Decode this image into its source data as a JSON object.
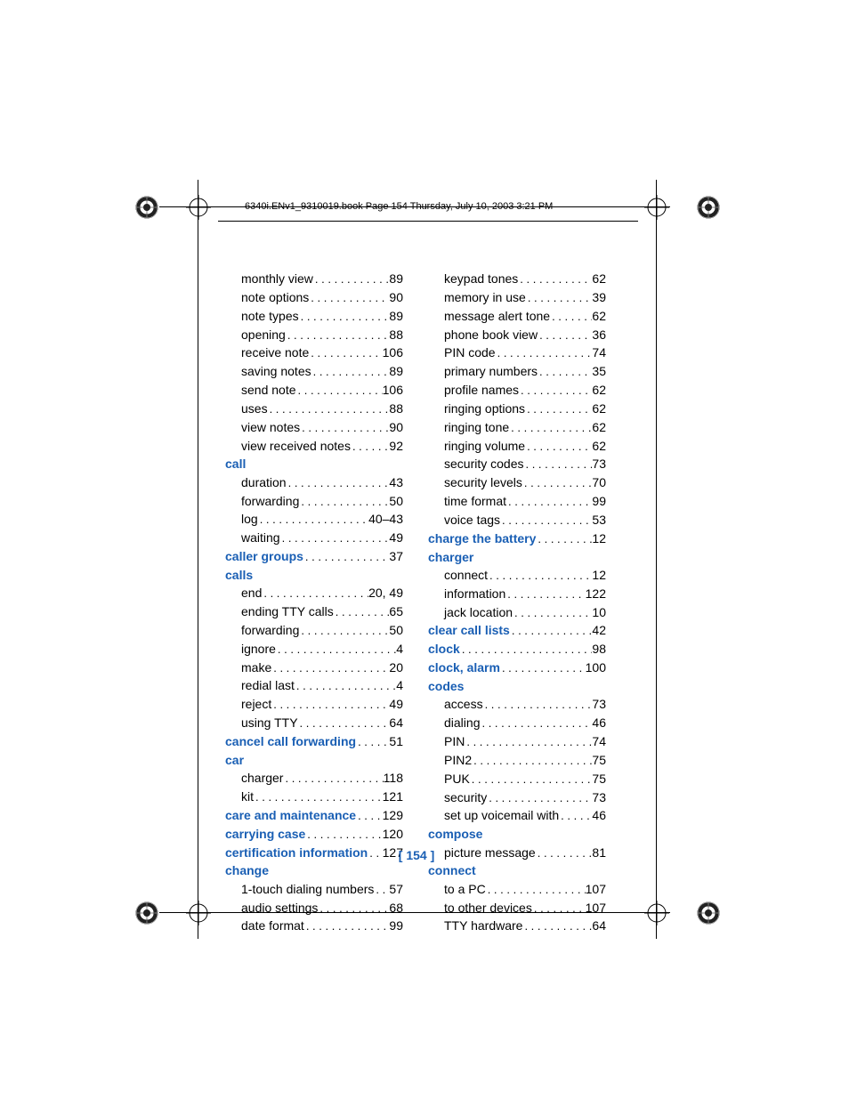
{
  "header": "6340i.ENv1_9310019.book  Page 154  Thursday, July 10, 2003  3:21 PM",
  "page_number": "[ 154 ]",
  "left_col": [
    {
      "label": "monthly view",
      "page": "89",
      "heading": false,
      "sub": true
    },
    {
      "label": "note options",
      "page": "90",
      "heading": false,
      "sub": true
    },
    {
      "label": "note types",
      "page": "89",
      "heading": false,
      "sub": true
    },
    {
      "label": "opening",
      "page": "88",
      "heading": false,
      "sub": true
    },
    {
      "label": "receive note",
      "page": "106",
      "heading": false,
      "sub": true
    },
    {
      "label": "saving notes",
      "page": "89",
      "heading": false,
      "sub": true
    },
    {
      "label": "send note",
      "page": "106",
      "heading": false,
      "sub": true
    },
    {
      "label": "uses",
      "page": "88",
      "heading": false,
      "sub": true
    },
    {
      "label": "view notes",
      "page": "90",
      "heading": false,
      "sub": true
    },
    {
      "label": "view received notes",
      "page": "92",
      "heading": false,
      "sub": true
    },
    {
      "label": "call",
      "page": "",
      "heading": true,
      "sub": false
    },
    {
      "label": "duration",
      "page": "43",
      "heading": false,
      "sub": true
    },
    {
      "label": "forwarding",
      "page": "50",
      "heading": false,
      "sub": true
    },
    {
      "label": "log",
      "page": "40–43",
      "heading": false,
      "sub": true
    },
    {
      "label": "waiting",
      "page": "49",
      "heading": false,
      "sub": true
    },
    {
      "label": "caller groups",
      "page": "37",
      "heading": true,
      "sub": false
    },
    {
      "label": "calls",
      "page": "",
      "heading": true,
      "sub": false
    },
    {
      "label": "end",
      "page": "20, 49",
      "heading": false,
      "sub": true
    },
    {
      "label": "ending TTY calls",
      "page": "65",
      "heading": false,
      "sub": true
    },
    {
      "label": "forwarding",
      "page": "50",
      "heading": false,
      "sub": true
    },
    {
      "label": "ignore",
      "page": "4",
      "heading": false,
      "sub": true
    },
    {
      "label": "make",
      "page": "20",
      "heading": false,
      "sub": true
    },
    {
      "label": "redial last",
      "page": "4",
      "heading": false,
      "sub": true
    },
    {
      "label": "reject",
      "page": "49",
      "heading": false,
      "sub": true
    },
    {
      "label": "using TTY",
      "page": "64",
      "heading": false,
      "sub": true
    },
    {
      "label": "cancel call forwarding",
      "page": "51",
      "heading": true,
      "sub": false
    },
    {
      "label": "car",
      "page": "",
      "heading": true,
      "sub": false
    },
    {
      "label": "charger",
      "page": "118",
      "heading": false,
      "sub": true
    },
    {
      "label": "kit",
      "page": "121",
      "heading": false,
      "sub": true
    },
    {
      "label": "care and maintenance",
      "page": "129",
      "heading": true,
      "sub": false
    },
    {
      "label": "carrying case",
      "page": "120",
      "heading": true,
      "sub": false
    },
    {
      "label": "certification information",
      "page": "127",
      "heading": true,
      "sub": false
    },
    {
      "label": "change",
      "page": "",
      "heading": true,
      "sub": false
    },
    {
      "label": "1-touch dialing numbers",
      "page": "57",
      "heading": false,
      "sub": true
    },
    {
      "label": "audio settings",
      "page": "68",
      "heading": false,
      "sub": true
    },
    {
      "label": "date format",
      "page": "99",
      "heading": false,
      "sub": true
    }
  ],
  "right_col": [
    {
      "label": "keypad tones",
      "page": "62",
      "heading": false,
      "sub": true
    },
    {
      "label": "memory in use",
      "page": "39",
      "heading": false,
      "sub": true
    },
    {
      "label": "message alert tone",
      "page": "62",
      "heading": false,
      "sub": true
    },
    {
      "label": "phone book view",
      "page": "36",
      "heading": false,
      "sub": true
    },
    {
      "label": "PIN code",
      "page": "74",
      "heading": false,
      "sub": true
    },
    {
      "label": "primary numbers",
      "page": "35",
      "heading": false,
      "sub": true
    },
    {
      "label": "profile names",
      "page": "62",
      "heading": false,
      "sub": true
    },
    {
      "label": "ringing options",
      "page": "62",
      "heading": false,
      "sub": true
    },
    {
      "label": "ringing tone",
      "page": "62",
      "heading": false,
      "sub": true
    },
    {
      "label": "ringing volume",
      "page": "62",
      "heading": false,
      "sub": true
    },
    {
      "label": "security codes",
      "page": "73",
      "heading": false,
      "sub": true
    },
    {
      "label": "security levels",
      "page": "70",
      "heading": false,
      "sub": true
    },
    {
      "label": "time format",
      "page": "99",
      "heading": false,
      "sub": true
    },
    {
      "label": "voice tags",
      "page": "53",
      "heading": false,
      "sub": true
    },
    {
      "label": "charge the battery",
      "page": "12",
      "heading": true,
      "sub": false
    },
    {
      "label": "charger",
      "page": "",
      "heading": true,
      "sub": false
    },
    {
      "label": "connect",
      "page": "12",
      "heading": false,
      "sub": true
    },
    {
      "label": "information",
      "page": "122",
      "heading": false,
      "sub": true
    },
    {
      "label": "jack location",
      "page": "10",
      "heading": false,
      "sub": true
    },
    {
      "label": "clear call lists",
      "page": "42",
      "heading": true,
      "sub": false
    },
    {
      "label": "clock",
      "page": "98",
      "heading": true,
      "sub": false
    },
    {
      "label": "clock, alarm",
      "page": "100",
      "heading": true,
      "sub": false
    },
    {
      "label": "codes",
      "page": "",
      "heading": true,
      "sub": false
    },
    {
      "label": "access",
      "page": "73",
      "heading": false,
      "sub": true
    },
    {
      "label": "dialing",
      "page": "46",
      "heading": false,
      "sub": true
    },
    {
      "label": "PIN",
      "page": "74",
      "heading": false,
      "sub": true
    },
    {
      "label": "PIN2",
      "page": "75",
      "heading": false,
      "sub": true
    },
    {
      "label": "PUK",
      "page": "75",
      "heading": false,
      "sub": true
    },
    {
      "label": "security",
      "page": "73",
      "heading": false,
      "sub": true
    },
    {
      "label": "set up voicemail with",
      "page": "46",
      "heading": false,
      "sub": true
    },
    {
      "label": "compose",
      "page": "",
      "heading": true,
      "sub": false
    },
    {
      "label": "picture message",
      "page": "81",
      "heading": false,
      "sub": true
    },
    {
      "label": "connect",
      "page": "",
      "heading": true,
      "sub": false
    },
    {
      "label": "to a PC",
      "page": "107",
      "heading": false,
      "sub": true
    },
    {
      "label": "to other devices",
      "page": "107",
      "heading": false,
      "sub": true
    },
    {
      "label": "TTY hardware",
      "page": "64",
      "heading": false,
      "sub": true
    }
  ]
}
